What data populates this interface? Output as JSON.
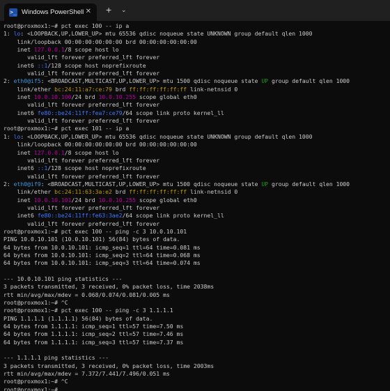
{
  "window": {
    "tab_title": "Windows PowerShell",
    "tab_icon": "powershell-icon",
    "tab_icon_glyph": ">_",
    "close_glyph": "✕",
    "new_tab_glyph": "+",
    "dropdown_glyph": "⌄"
  },
  "colors": {
    "background": "#0c0c0c",
    "foreground": "#cccccc",
    "blue": "#3b78ff",
    "magenta": "#b4009e",
    "yellow": "#c19c00",
    "green": "#13a10e",
    "cyan": "#3a96dd"
  },
  "terminal": {
    "lines": [
      [
        {
          "t": "root@proxmox1:~# pct exec 100 -- ip a"
        }
      ],
      [
        {
          "t": "1: "
        },
        {
          "t": "lo",
          "c": "blue"
        },
        {
          "t": ": <LOOPBACK,UP,LOWER_UP> mtu 65536 qdisc noqueue state UNKNOWN group default qlen 1000"
        }
      ],
      [
        {
          "t": "    link/loopback 00:00:00:00:00:00 brd 00:00:00:00:00:00"
        }
      ],
      [
        {
          "t": "    inet "
        },
        {
          "t": "127.0.0.1",
          "c": "mag"
        },
        {
          "t": "/8 scope host lo"
        }
      ],
      [
        {
          "t": "       valid_lft forever preferred_lft forever"
        }
      ],
      [
        {
          "t": "    inet6 "
        },
        {
          "t": "::1",
          "c": "blue"
        },
        {
          "t": "/128 scope host noprefixroute"
        }
      ],
      [
        {
          "t": "       valid_lft forever preferred_lft forever"
        }
      ],
      [
        {
          "t": "2: "
        },
        {
          "t": "eth0@if5",
          "c": "cyan"
        },
        {
          "t": ": <BROADCAST,MULTICAST,UP,LOWER_UP> mtu 1500 qdisc noqueue state "
        },
        {
          "t": "UP",
          "c": "grn"
        },
        {
          "t": " group default qlen 1000"
        }
      ],
      [
        {
          "t": "    link/ether "
        },
        {
          "t": "bc:24:11:a7:ce:79",
          "c": "yel"
        },
        {
          "t": " brd "
        },
        {
          "t": "ff:ff:ff:ff:ff:ff",
          "c": "yel"
        },
        {
          "t": " link-netnsid 0"
        }
      ],
      [
        {
          "t": "    inet "
        },
        {
          "t": "10.0.10.100",
          "c": "mag"
        },
        {
          "t": "/24 brd "
        },
        {
          "t": "10.0.10.255",
          "c": "mag"
        },
        {
          "t": " scope global eth0"
        }
      ],
      [
        {
          "t": "       valid_lft forever preferred_lft forever"
        }
      ],
      [
        {
          "t": "    inet6 "
        },
        {
          "t": "fe80::be24:11ff:fea7:ce79",
          "c": "blue"
        },
        {
          "t": "/64 scope link proto kernel_ll"
        }
      ],
      [
        {
          "t": "       valid_lft forever preferred_lft forever"
        }
      ],
      [
        {
          "t": "root@proxmox1:~# pct exec 101 -- ip a"
        }
      ],
      [
        {
          "t": "1: "
        },
        {
          "t": "lo",
          "c": "blue"
        },
        {
          "t": ": <LOOPBACK,UP,LOWER_UP> mtu 65536 qdisc noqueue state UNKNOWN group default qlen 1000"
        }
      ],
      [
        {
          "t": "    link/loopback 00:00:00:00:00:00 brd 00:00:00:00:00:00"
        }
      ],
      [
        {
          "t": "    inet "
        },
        {
          "t": "127.0.0.1",
          "c": "mag"
        },
        {
          "t": "/8 scope host lo"
        }
      ],
      [
        {
          "t": "       valid_lft forever preferred_lft forever"
        }
      ],
      [
        {
          "t": "    inet6 "
        },
        {
          "t": "::1",
          "c": "blue"
        },
        {
          "t": "/128 scope host noprefixroute"
        }
      ],
      [
        {
          "t": "       valid_lft forever preferred_lft forever"
        }
      ],
      [
        {
          "t": "2: "
        },
        {
          "t": "eth0@if9",
          "c": "cyan"
        },
        {
          "t": ": <BROADCAST,MULTICAST,UP,LOWER_UP> mtu 1500 qdisc noqueue state "
        },
        {
          "t": "UP",
          "c": "grn"
        },
        {
          "t": " group default qlen 1000"
        }
      ],
      [
        {
          "t": "    link/ether "
        },
        {
          "t": "bc:24:11:63:3a:e2",
          "c": "yel"
        },
        {
          "t": " brd "
        },
        {
          "t": "ff:ff:ff:ff:ff:ff",
          "c": "yel"
        },
        {
          "t": " link-netnsid 0"
        }
      ],
      [
        {
          "t": "    inet "
        },
        {
          "t": "10.0.10.101",
          "c": "mag"
        },
        {
          "t": "/24 brd "
        },
        {
          "t": "10.0.10.255",
          "c": "mag"
        },
        {
          "t": " scope global eth0"
        }
      ],
      [
        {
          "t": "       valid_lft forever preferred_lft forever"
        }
      ],
      [
        {
          "t": "    inet6 "
        },
        {
          "t": "fe80::be24:11ff:fe63:3ae2",
          "c": "blue"
        },
        {
          "t": "/64 scope link proto kernel_ll"
        }
      ],
      [
        {
          "t": "       valid_lft forever preferred_lft forever"
        }
      ],
      [
        {
          "t": "root@proxmox1:~# pct exec 100 -- ping -c 3 10.0.10.101"
        }
      ],
      [
        {
          "t": "PING 10.0.10.101 (10.0.10.101) 56(84) bytes of data."
        }
      ],
      [
        {
          "t": "64 bytes from 10.0.10.101: icmp_seq=1 ttl=64 time=0.081 ms"
        }
      ],
      [
        {
          "t": "64 bytes from 10.0.10.101: icmp_seq=2 ttl=64 time=0.068 ms"
        }
      ],
      [
        {
          "t": "64 bytes from 10.0.10.101: icmp_seq=3 ttl=64 time=0.074 ms"
        }
      ],
      [
        {
          "t": ""
        }
      ],
      [
        {
          "t": "--- 10.0.10.101 ping statistics ---"
        }
      ],
      [
        {
          "t": "3 packets transmitted, 3 received, 0% packet loss, time 2038ms"
        }
      ],
      [
        {
          "t": "rtt min/avg/max/mdev = 0.068/0.074/0.081/0.005 ms"
        }
      ],
      [
        {
          "t": "root@proxmox1:~# ^C"
        }
      ],
      [
        {
          "t": "root@proxmox1:~# pct exec 100 -- ping -c 3 1.1.1.1"
        }
      ],
      [
        {
          "t": "PING 1.1.1.1 (1.1.1.1) 56(84) bytes of data."
        }
      ],
      [
        {
          "t": "64 bytes from 1.1.1.1: icmp_seq=1 ttl=57 time=7.50 ms"
        }
      ],
      [
        {
          "t": "64 bytes from 1.1.1.1: icmp_seq=2 ttl=57 time=7.46 ms"
        }
      ],
      [
        {
          "t": "64 bytes from 1.1.1.1: icmp_seq=3 ttl=57 time=7.37 ms"
        }
      ],
      [
        {
          "t": ""
        }
      ],
      [
        {
          "t": "--- 1.1.1.1 ping statistics ---"
        }
      ],
      [
        {
          "t": "3 packets transmitted, 3 received, 0% packet loss, time 2003ms"
        }
      ],
      [
        {
          "t": "rtt min/avg/max/mdev = 7.372/7.441/7.496/0.051 ms"
        }
      ],
      [
        {
          "t": "root@proxmox1:~# ^C"
        }
      ],
      [
        {
          "t": "root@proxmox1:~# "
        }
      ]
    ]
  }
}
